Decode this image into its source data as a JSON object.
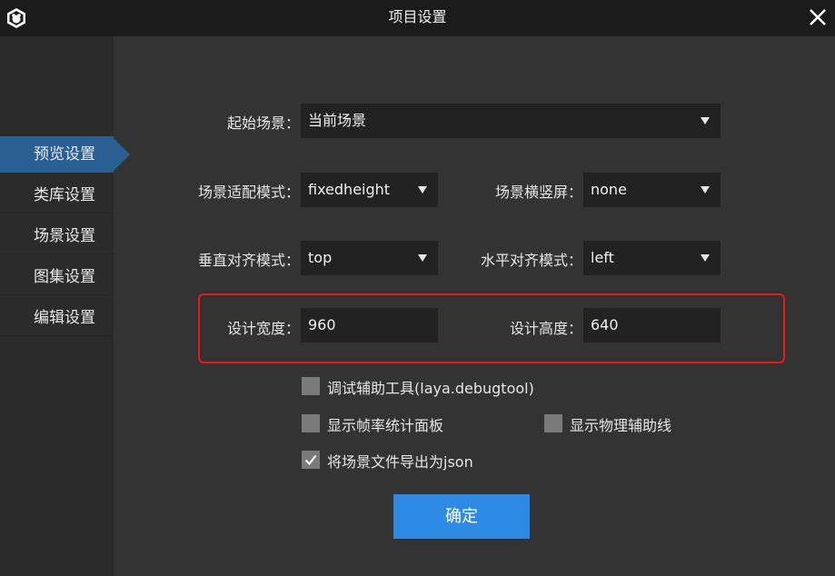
{
  "window": {
    "title": "项目设置",
    "icons": {
      "app": "laya-logo-icon",
      "close": "close-icon"
    }
  },
  "sidebar": {
    "items": [
      {
        "label": "预览设置",
        "active": true
      },
      {
        "label": "类库设置",
        "active": false
      },
      {
        "label": "场景设置",
        "active": false
      },
      {
        "label": "图集设置",
        "active": false
      },
      {
        "label": "编辑设置",
        "active": false
      }
    ]
  },
  "form": {
    "start_scene": {
      "label": "起始场景：",
      "value": "当前场景"
    },
    "scale_mode": {
      "label": "场景适配模式：",
      "value": "fixedheight"
    },
    "screen_orientation": {
      "label": "场景横竖屏：",
      "value": "none"
    },
    "vertical_align": {
      "label": "垂直对齐模式：",
      "value": "top"
    },
    "horizontal_align": {
      "label": "水平对齐模式：",
      "value": "left"
    },
    "design_width": {
      "label": "设计宽度：",
      "value": "960"
    },
    "design_height": {
      "label": "设计高度：",
      "value": "640"
    }
  },
  "options": {
    "debug_tool": {
      "label": "调试辅助工具(laya.debugtool)",
      "checked": false
    },
    "show_fps": {
      "label": "显示帧率统计面板",
      "checked": false
    },
    "show_physics": {
      "label": "显示物理辅助线",
      "checked": false
    },
    "export_json": {
      "label": "将场景文件导出为json",
      "checked": true
    }
  },
  "buttons": {
    "ok": "确定"
  },
  "colors": {
    "titlebar": "#1b1b1b",
    "main_bg": "#333333",
    "sidebar_bg": "#2b2b2b",
    "active_nav": "#2a5f94",
    "field_bg": "#222222",
    "highlight": "#e8191c",
    "primary_button": "#2d8be6"
  }
}
